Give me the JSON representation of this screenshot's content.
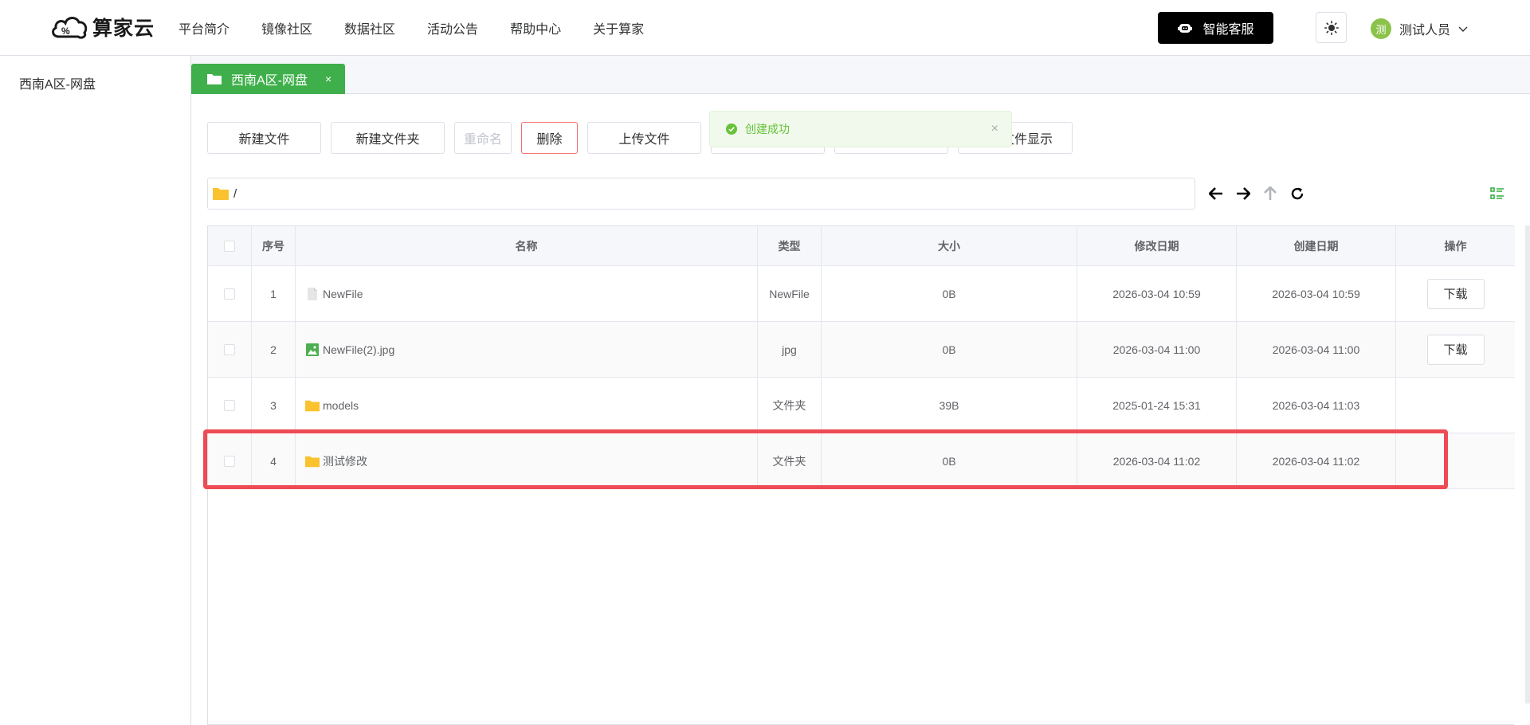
{
  "brand": {
    "name": "算家云",
    "accent": "#3eaf4a"
  },
  "nav": {
    "items": [
      "平台简介",
      "镜像社区",
      "数据社区",
      "活动公告",
      "帮助中心",
      "关于算家"
    ]
  },
  "header": {
    "service_label": "智能客服",
    "theme_icon": "sun-icon",
    "user": {
      "avatar_text": "测",
      "name": "测试人员"
    }
  },
  "sidebar": {
    "items": [
      {
        "label": "西南A区-网盘"
      }
    ]
  },
  "tabs": [
    {
      "label": "西南A区-网盘",
      "close": "×"
    }
  ],
  "toolbar": {
    "new_file": "新建文件",
    "new_folder": "新建文件夹",
    "rename": "重命名",
    "delete": "删除",
    "upload": "上传文件",
    "show_files": "文件显示"
  },
  "toast": {
    "message": "创建成功",
    "close": "×"
  },
  "path": {
    "value": "/"
  },
  "table": {
    "headers": {
      "index": "序号",
      "name": "名称",
      "type": "类型",
      "size": "大小",
      "modified": "修改日期",
      "created": "创建日期",
      "ops": "操作"
    },
    "rows": [
      {
        "index": "1",
        "name": "NewFile",
        "icon": "file-icon",
        "type": "NewFile",
        "size": "0B",
        "modified": "2026-03-04 10:59",
        "created": "2026-03-04 10:59",
        "action": "下载"
      },
      {
        "index": "2",
        "name": "NewFile(2).jpg",
        "icon": "image-file-icon",
        "type": "jpg",
        "size": "0B",
        "modified": "2026-03-04 11:00",
        "created": "2026-03-04 11:00",
        "action": "下载"
      },
      {
        "index": "3",
        "name": "models",
        "icon": "folder-icon",
        "type": "文件夹",
        "size": "39B",
        "modified": "2025-01-24 15:31",
        "created": "2026-03-04 11:03",
        "action": ""
      },
      {
        "index": "4",
        "name": "测试修改",
        "icon": "folder-icon",
        "type": "文件夹",
        "size": "0B",
        "modified": "2026-03-04 11:02",
        "created": "2026-03-04 11:02",
        "action": ""
      }
    ]
  },
  "colors": {
    "highlight": "#ee4b55",
    "folder": "#f9c22e",
    "success": "#67c23a"
  }
}
